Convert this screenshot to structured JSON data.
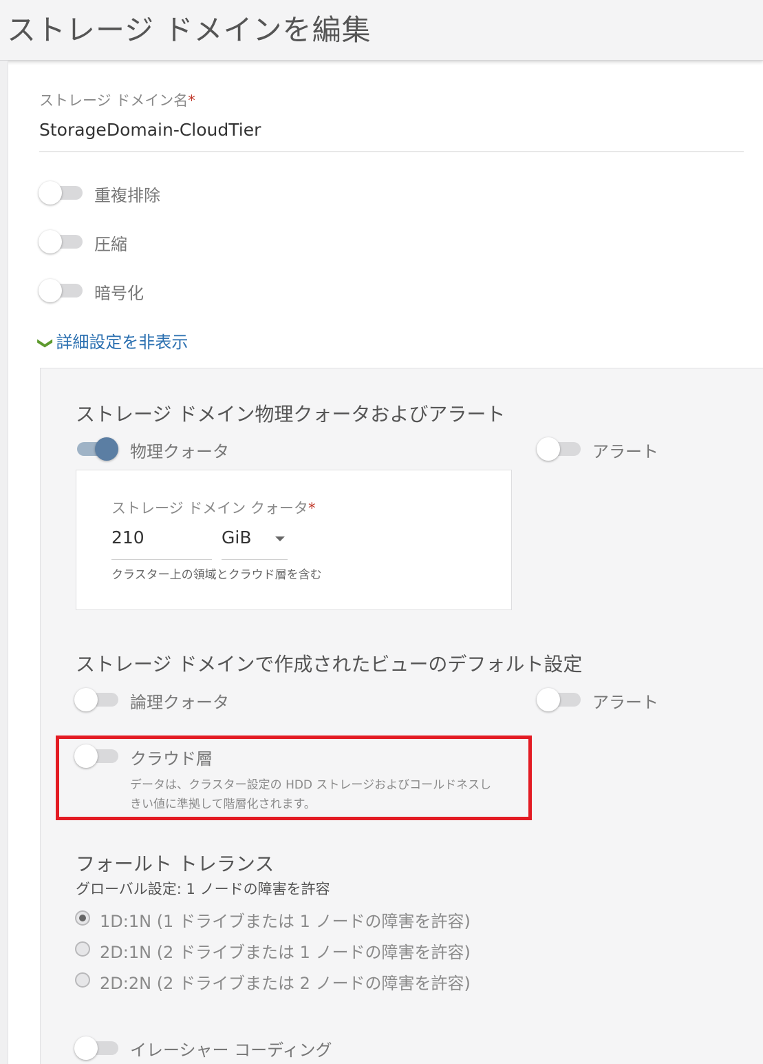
{
  "header": {
    "title": "ストレージ ドメインを編集"
  },
  "name_field": {
    "label": "ストレージ ドメイン名",
    "required_mark": "*",
    "value": "StorageDomain-CloudTier"
  },
  "toggles_basic": [
    {
      "label": "重複排除",
      "on": false
    },
    {
      "label": "圧縮",
      "on": false
    },
    {
      "label": "暗号化",
      "on": false
    }
  ],
  "advanced_link": {
    "chevron": "❯",
    "label": "詳細設定を非表示"
  },
  "quota_section": {
    "title": "ストレージ ドメイン物理クォータおよびアラート",
    "physical_quota_label": "物理クォータ",
    "physical_quota_on": true,
    "alert_label": "アラート",
    "alert_on": false,
    "box": {
      "label": "ストレージ ドメイン クォータ",
      "required_mark": "*",
      "value": "210",
      "unit": "GiB",
      "hint": "クラスター上の領域とクラウド層を含む"
    }
  },
  "view_defaults": {
    "title": "ストレージ ドメインで作成されたビューのデフォルト設定",
    "logical_quota_label": "論理クォータ",
    "alert_label": "アラート",
    "cloud_tier_label": "クラウド層",
    "cloud_tier_hint_line1": "データは、クラスター設定の HDD ストレージおよびコールドネスし",
    "cloud_tier_hint_line2": "きい値に準拠して階層化されます。"
  },
  "fault_tolerance": {
    "title": "フォールト トレランス",
    "global_setting": "グローバル設定: 1 ノードの障害を許容",
    "options": [
      {
        "label": "1D:1N (1 ドライブまたは 1 ノードの障害を許容)",
        "selected": true
      },
      {
        "label": "2D:1N (2 ドライブまたは 1 ノードの障害を許容)",
        "selected": false
      },
      {
        "label": "2D:2N (2 ドライブまたは 2 ノードの障害を許容)",
        "selected": false
      }
    ]
  },
  "erasure_coding": {
    "label": "イレーシャー コーディング"
  },
  "colors": {
    "accent_link": "#2a6fb0",
    "toggle_on": "#5b7ea3",
    "highlight": "#e31b23",
    "required": "#c0392b"
  }
}
